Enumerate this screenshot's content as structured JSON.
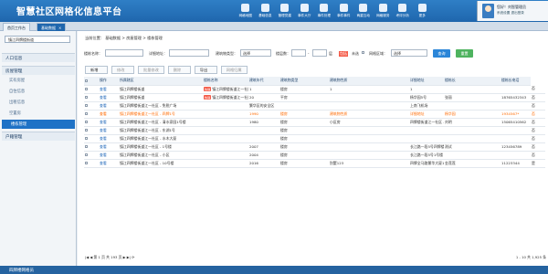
{
  "app_title": "智慧社区网格化信息平台",
  "nav": [
    {
      "label": "网格地图",
      "icon": "map-icon"
    },
    {
      "label": "基础信息",
      "icon": "info-icon"
    },
    {
      "label": "管理党建",
      "icon": "party-icon"
    },
    {
      "label": "事件大厅",
      "icon": "event-icon"
    },
    {
      "label": "事件处理",
      "icon": "process-icon"
    },
    {
      "label": "事件事件",
      "icon": "list-icon"
    },
    {
      "label": "两重互动",
      "icon": "interact-icon"
    },
    {
      "label": "网格服务",
      "icon": "service-icon"
    },
    {
      "label": "考评分析",
      "icon": "analysis-icon"
    },
    {
      "label": "更多",
      "icon": "more-icon"
    }
  ],
  "user": {
    "name": "您好！刘智管理员",
    "sub": "系统设置  退出登录"
  },
  "tabs": {
    "home": "首页工作台",
    "current": "基础数据",
    "close": "×"
  },
  "sidebar": {
    "select": "镇江四牌楼街道",
    "sections": [
      {
        "label": "人口信息"
      },
      {
        "label": "房屋管理"
      },
      {
        "label": "户籍管理"
      }
    ],
    "items": [
      {
        "label": "实有房屋"
      },
      {
        "label": "自住信息"
      },
      {
        "label": "出租信息"
      },
      {
        "label": "空置房"
      },
      {
        "label": "楼栋管理"
      }
    ]
  },
  "breadcrumb": "当前位置： 基础数据 > 房屋管理 > 楼栋管理",
  "filters": {
    "building_name": "楼栋名称：",
    "address": "详细地址：",
    "building_type": "建筑物类型：",
    "type_value": "选择",
    "floors": "楼层数：",
    "floors_value": "-",
    "floors_unit": "层",
    "search_all": "包括",
    "is_select": "未选",
    "zone": "网格区域：",
    "zone_value": "选择",
    "query": "查询",
    "reset": "重置"
  },
  "toolbar": [
    "新增",
    "修改",
    "批量修改",
    "删除",
    "导出",
    "网格归属"
  ],
  "table": {
    "headers": [
      "操作",
      "所属辖区",
      "楼栋名称",
      "建筑年代",
      "建筑物类型",
      "建筑物性质",
      "详细地址",
      "楼栋长",
      "楼栋长电话",
      "地图标注"
    ],
    "rows": [
      [
        "查看",
        "镇江四牌楼街道",
        "镇江四牌楼街道江一社区 - 花园",
        "1",
        "楼房",
        "1",
        "1",
        "",
        "",
        "否"
      ],
      [
        "查看",
        "镇江四牌楼街道",
        "镇江四牌楼街道江一社区 - 湖边花园",
        "20",
        "平房",
        "",
        "杨华园5号",
        "张丽",
        "18765432343",
        "否"
      ],
      [
        "查看",
        "镇江四牌楼街道江一社区 - 免税广场",
        "",
        "繁华区的安全区",
        "",
        "",
        "上南飞机场",
        "",
        "",
        "否"
      ],
      [
        "查看",
        "镇江四牌楼街道江一社区 - 四牌1号",
        "",
        "1990",
        "楼房",
        "建筑物性质",
        "详细地址",
        "杨华园",
        "1934567*",
        "否"
      ],
      [
        "查看",
        "镇江四牌楼街道江一社区 - 清水家园1号楼",
        "",
        "1980",
        "楼房",
        "小区房",
        "四牌楼街道江一社区 - 四牌",
        "刘明",
        "15065410562",
        "否"
      ],
      [
        "查看",
        "镇江四牌楼街道江一社区 - 东湖1号",
        "",
        "",
        "楼房",
        "",
        "",
        "",
        "",
        "否"
      ],
      [
        "查看",
        "镇江四牌楼街道江一社区 - 水木大厦",
        "",
        "",
        "楼房",
        "",
        "",
        "",
        "",
        "否"
      ],
      [
        "查看",
        "镇江四牌楼街道江一社区 - 1号楼",
        "",
        "2007",
        "楼房",
        "",
        "长江路一段5号四牌楼南门",
        "测试",
        "123456789",
        "否"
      ],
      [
        "查看",
        "镇江四牌楼街道江一社区 - 小区",
        "",
        "2004",
        "楼房",
        "",
        "长江路一段5号1号楼",
        "",
        "",
        "否"
      ],
      [
        "查看",
        "镇江四牌楼街道江一社区 - 10号楼",
        "",
        "2016",
        "楼房",
        "别墅123",
        "四牌全马路繁华大厦101号",
        "金莲莲",
        "11223344",
        "是"
      ]
    ]
  },
  "highlight_row": 3,
  "tagged_rows": [
    0,
    1
  ],
  "tag_text": "热销",
  "pager": {
    "left": "|◀  ◀  第 1 页 共 193 页  ▶  ▶|  ⟳",
    "right": "1 - 10  共 1,925 条"
  },
  "status": "四牌楼网格员"
}
